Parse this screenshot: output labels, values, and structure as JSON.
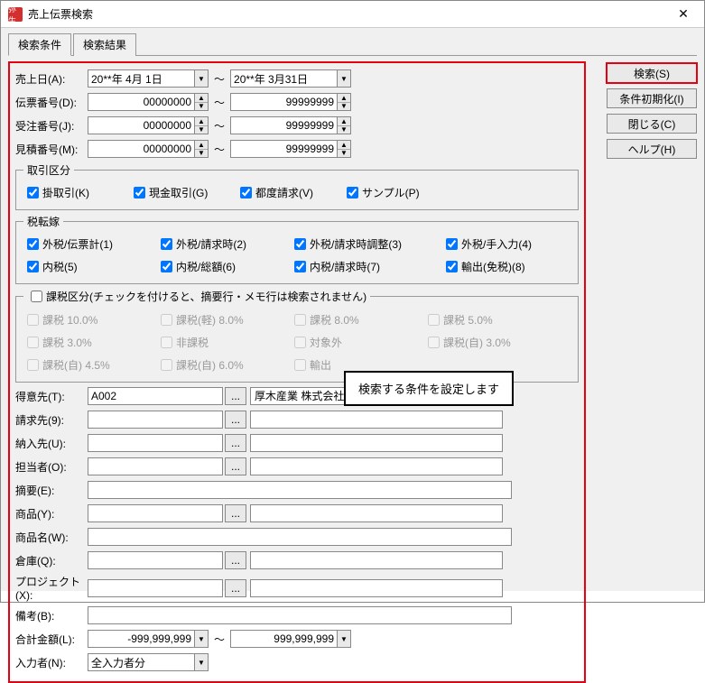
{
  "window": {
    "title": "売上伝票検索",
    "logo_text": "弥生"
  },
  "tabs": {
    "t0": "検索条件",
    "t1": "検索結果"
  },
  "buttons": {
    "search": "検索(S)",
    "init": "条件初期化(I)",
    "close": "閉じる(C)",
    "help": "ヘルプ(H)"
  },
  "labels": {
    "sales_date": "売上日(A):",
    "slip_no": "伝票番号(D):",
    "order_no": "受注番号(J):",
    "quote_no": "見積番号(M):",
    "customer": "得意先(T):",
    "bill_to": "請求先(9):",
    "ship_to": "納入先(U):",
    "staff": "担当者(O):",
    "summary": "摘要(E):",
    "product": "商品(Y):",
    "product_name": "商品名(W):",
    "warehouse": "倉庫(Q):",
    "project": "プロジェクト(X):",
    "note": "備考(B):",
    "total": "合計金額(L):",
    "entered_by": "入力者(N):"
  },
  "values": {
    "date_from": "20**年 4月 1日",
    "date_to": "20**年 3月31日",
    "slip_from": "00000000",
    "slip_to": "99999999",
    "order_from": "00000000",
    "order_to": "99999999",
    "quote_from": "00000000",
    "quote_to": "99999999",
    "customer_code": "A002",
    "customer_name": "厚木産業 株式会社",
    "total_from": "-999,999,999",
    "total_to": "999,999,999",
    "entered_by": "全入力者分"
  },
  "trans_section": {
    "legend": "取引区分",
    "c0": "掛取引(K)",
    "c1": "現金取引(G)",
    "c2": "都度請求(V)",
    "c3": "サンプル(P)"
  },
  "tax_shift": {
    "legend": "税転嫁",
    "c0": "外税/伝票計(1)",
    "c1": "外税/請求時(2)",
    "c2": "外税/請求時調整(3)",
    "c3": "外税/手入力(4)",
    "c4": "内税(5)",
    "c5": "内税/総額(6)",
    "c6": "内税/請求時(7)",
    "c7": "輸出(免税)(8)"
  },
  "tax_class": {
    "legend": "課税区分(チェックを付けると、摘要行・メモ行は検索されません)",
    "c0": "課税 10.0%",
    "c1": "課税(軽) 8.0%",
    "c2": "課税 8.0%",
    "c3": "課税 5.0%",
    "c4": "課税 3.0%",
    "c5": "非課税",
    "c6": "対象外",
    "c7": "課税(自) 3.0%",
    "c8": "課税(自) 4.5%",
    "c9": "課税(自) 6.0%",
    "c10": "輸出"
  },
  "callout": "検索する条件を設定します"
}
